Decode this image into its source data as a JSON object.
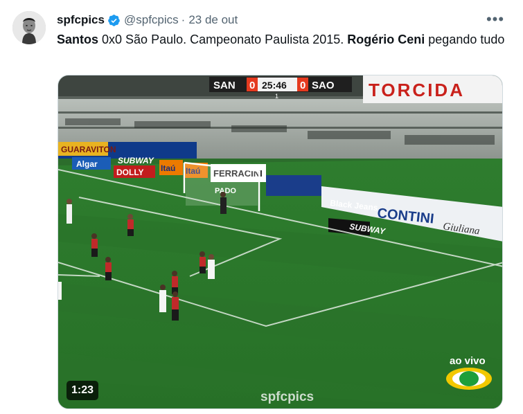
{
  "tweet": {
    "author_name": "spfcpics",
    "handle": "@spfcpics",
    "separator": "·",
    "time": "23 de out",
    "more_label": "•••",
    "text": {
      "part1": "Santos",
      "part2": " 0x0 São Paulo. Campeonato Paulista 2015. ",
      "part3": "Rogério Ceni",
      "part4": " pegando tudo"
    }
  },
  "video": {
    "duration": "1:23",
    "scoreboard": {
      "home": "SAN",
      "home_score": "0",
      "clock": "25:46",
      "away_score": "0",
      "away": "SAO",
      "period": "1"
    },
    "watermark": "spfcpics",
    "live_label": "ao vivo",
    "ads": {
      "torcida": "TORCIDA",
      "guaraviton": "GUARAVITON",
      "subway": "SUBWAY",
      "itau": "Itaú",
      "algar": "Algar",
      "dolly": "DOLLY",
      "ferracini": "FERRACINI",
      "black_jeans": "Black Jeans",
      "contini": "CONTINI",
      "giuliana": "Giuliana",
      "pado": "PADO"
    }
  },
  "colors": {
    "verified": "#1d9bf0",
    "grass": "#2f7a2f",
    "grass_dark": "#286b28"
  },
  "icons": {
    "verified": "verified-badge-icon",
    "more": "more-icon"
  }
}
